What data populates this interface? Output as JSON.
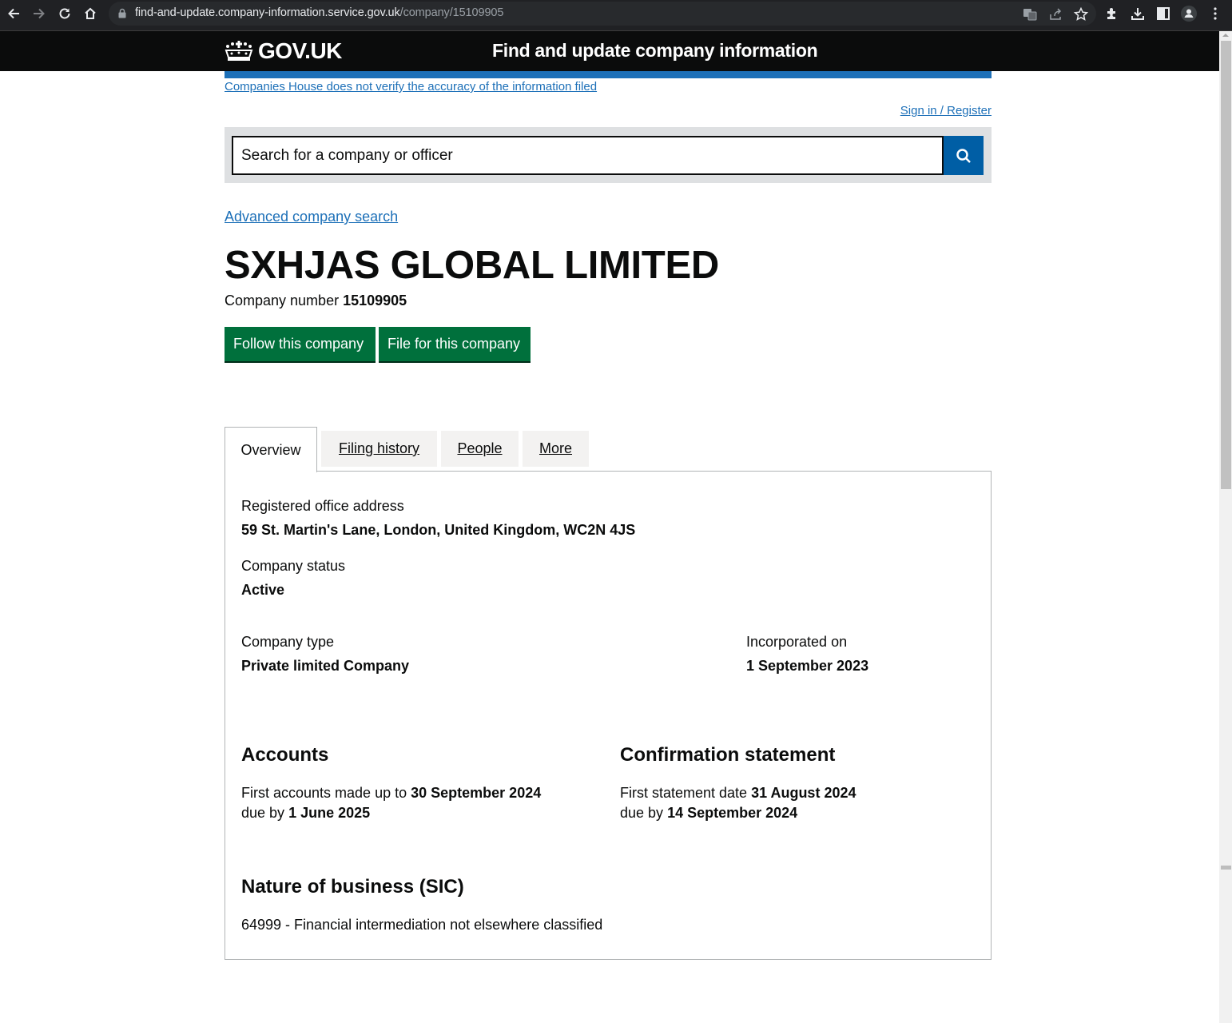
{
  "browser": {
    "url_host": "find-and-update.company-information.service.gov.uk",
    "url_path": "/company/15109905",
    "icons": [
      "back-icon",
      "forward-icon",
      "reload-icon",
      "home-icon",
      "lock-icon",
      "translate-icon",
      "share-icon",
      "bookmark-star-icon",
      "extensions-icon",
      "download-icon",
      "side-panel-icon",
      "profile-icon",
      "menu-icon"
    ]
  },
  "header": {
    "logo_text": "GOV.UK",
    "service_name": "Find and update company information",
    "disclaimer_link": "Companies House does not verify the accuracy of the information filed",
    "signin_link": "Sign in / Register"
  },
  "search": {
    "placeholder": "Search for a company or officer",
    "value": "",
    "advanced_link": "Advanced company search"
  },
  "company": {
    "name": "SXHJAS GLOBAL LIMITED",
    "number_label": "Company number",
    "number": "15109905",
    "actions": {
      "follow": "Follow this company",
      "file": "File for this company"
    }
  },
  "tabs": [
    {
      "label": "Overview",
      "active": true
    },
    {
      "label": "Filing history",
      "active": false
    },
    {
      "label": "People",
      "active": false
    },
    {
      "label": "More",
      "active": false
    }
  ],
  "overview": {
    "registered_office": {
      "label": "Registered office address",
      "value": "59 St. Martin's Lane, London, United Kingdom, WC2N 4JS"
    },
    "status": {
      "label": "Company status",
      "value": "Active"
    },
    "type": {
      "label": "Company type",
      "value": "Private limited Company"
    },
    "incorporated": {
      "label": "Incorporated on",
      "value": "1 September 2023"
    },
    "accounts": {
      "heading": "Accounts",
      "line1_prefix": "First accounts made up to",
      "line1_value": "30 September 2024",
      "line2_prefix": "due by",
      "line2_value": "1 June 2025"
    },
    "confirmation": {
      "heading": "Confirmation statement",
      "line1_prefix": "First statement date",
      "line1_value": "31 August 2024",
      "line2_prefix": "due by",
      "line2_value": "14 September 2024"
    },
    "sic": {
      "heading": "Nature of business (SIC)",
      "value": "64999 - Financial intermediation not elsewhere classified"
    }
  }
}
